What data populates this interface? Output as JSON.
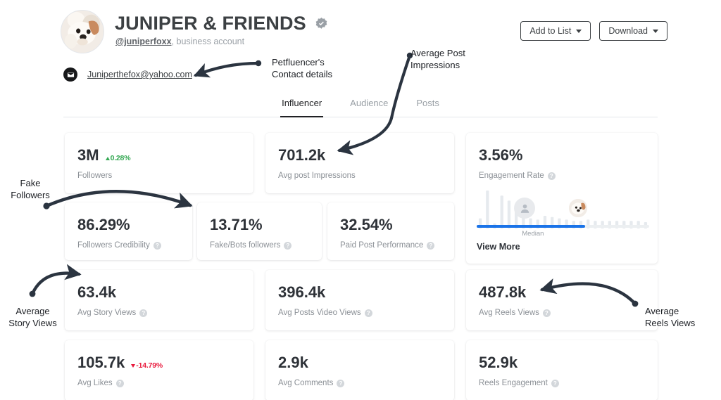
{
  "profile": {
    "name": "JUNIPER & FRIENDS",
    "verified_icon": "verified-badge-icon",
    "handle": "@juniperfoxx",
    "account_type": ", business account",
    "email": "Juniperthefox@yahoo.com",
    "email_icon": "envelope-icon",
    "avatar_icon": "dog-avatar"
  },
  "header": {
    "add_to_list_label": "Add to List",
    "download_label": "Download",
    "caret_icon": "caret-down-icon"
  },
  "tabs": [
    {
      "label": "Influencer",
      "active": true
    },
    {
      "label": "Audience",
      "active": false
    },
    {
      "label": "Posts",
      "active": false
    }
  ],
  "cards": [
    {
      "id": "followers",
      "value": "3M",
      "delta": "0.28%",
      "delta_dir": "up",
      "label": "Followers",
      "help": false
    },
    {
      "id": "avg-post-impressions",
      "value": "701.2k",
      "label": "Avg post Impressions",
      "help": false
    },
    {
      "id": "engagement-rate",
      "value": "3.56%",
      "label": "Engagement Rate",
      "help": true,
      "median_label": "Median",
      "view_more_label": "View More"
    },
    {
      "id": "followers-credibility",
      "value": "86.29%",
      "label": "Followers  Credibility",
      "help": true
    },
    {
      "id": "fake-bots-followers",
      "value": "13.71%",
      "label": "Fake/Bots followers",
      "help": true
    },
    {
      "id": "paid-post-performance",
      "value": "32.54%",
      "label": "Paid Post Performance",
      "help": true
    },
    {
      "id": "avg-story-views",
      "value": "63.4k",
      "label": "Avg Story Views",
      "help": true
    },
    {
      "id": "avg-posts-video-views",
      "value": "396.4k",
      "label": "Avg Posts Video Views",
      "help": true
    },
    {
      "id": "avg-reels-views",
      "value": "487.8k",
      "label": "Avg Reels Views",
      "help": true
    },
    {
      "id": "avg-likes",
      "value": "105.7k",
      "delta": "-14.79%",
      "delta_dir": "down",
      "label": "Avg Likes",
      "help": true
    },
    {
      "id": "avg-comments",
      "value": "2.9k",
      "label": "Avg Comments",
      "help": true
    },
    {
      "id": "reels-engagement",
      "value": "52.9k",
      "label": "Reels Engagement",
      "help": true
    }
  ],
  "annotations": [
    {
      "id": "contact-details",
      "text": "Petfluencer's\nContact details"
    },
    {
      "id": "average-post-impressions",
      "text": "Average Post\nImpressions"
    },
    {
      "id": "fake-followers",
      "text": "Fake\nFollowers"
    },
    {
      "id": "average-story-views",
      "text": "Average\nStory Views"
    },
    {
      "id": "average-reels-views",
      "text": "Average\nReels Views"
    }
  ],
  "colors": {
    "accent_blue": "#1a73e8",
    "positive_green": "#34a853",
    "negative_red": "#e8193c",
    "text_dark": "#2e3238",
    "text_muted": "#8b9096",
    "annotation": "#2b3440"
  },
  "chart_data": {
    "type": "bar",
    "title": "Engagement Rate distribution",
    "xlabel": "",
    "ylabel": "",
    "grid": false,
    "legend": "none",
    "median_marker": "Median",
    "median_fraction": 0.63,
    "bars": [
      8,
      30,
      4,
      26,
      22,
      18,
      12,
      8,
      7,
      10,
      9,
      8,
      7,
      6,
      6,
      7,
      6,
      6,
      6,
      6,
      6,
      6,
      6,
      5
    ]
  }
}
